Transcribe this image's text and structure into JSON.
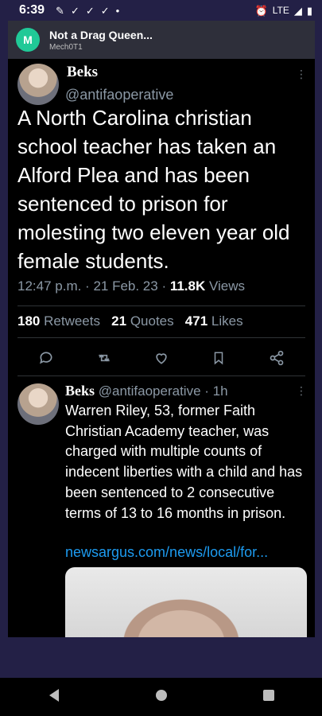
{
  "status_bar": {
    "time": "6:39",
    "network": "LTE",
    "icons": [
      "notification-icon",
      "check-icon",
      "check-icon",
      "check-icon",
      "dot-icon",
      "alarm-icon",
      "signal-icon",
      "battery-icon"
    ]
  },
  "notification": {
    "avatar_letter": "M",
    "title": "Not a Drag Queen...",
    "subtitle": "Mech0T1"
  },
  "tweet": {
    "name": "Beks",
    "handle": "@antifaoperative",
    "text": "A North Carolina christian school teacher has taken an Alford Plea and has been sentenced to prison for molesting two eleven year old female students.",
    "time": "12:47 p.m.",
    "date": "21 Feb. 23",
    "views_count": "11.8K",
    "views_label": "Views",
    "retweets_count": "180",
    "retweets_label": "Retweets",
    "quotes_count": "21",
    "quotes_label": "Quotes",
    "likes_count": "471",
    "likes_label": "Likes"
  },
  "reply": {
    "name": "Beks",
    "handle": "@antifaoperative",
    "age": "1h",
    "text": "Warren Riley, 53, former Faith Christian Academy teacher, was charged with multiple counts of indecent liberties with a child and has been sentenced to 2 consecutive terms of 13 to 16 months in prison.",
    "link": "newsargus.com/news/local/for..."
  },
  "colors": {
    "background": "#232046",
    "panel": "#000000",
    "accent_link": "#1d9bf0",
    "muted": "#8b98a5",
    "notif_avatar": "#20c997"
  }
}
